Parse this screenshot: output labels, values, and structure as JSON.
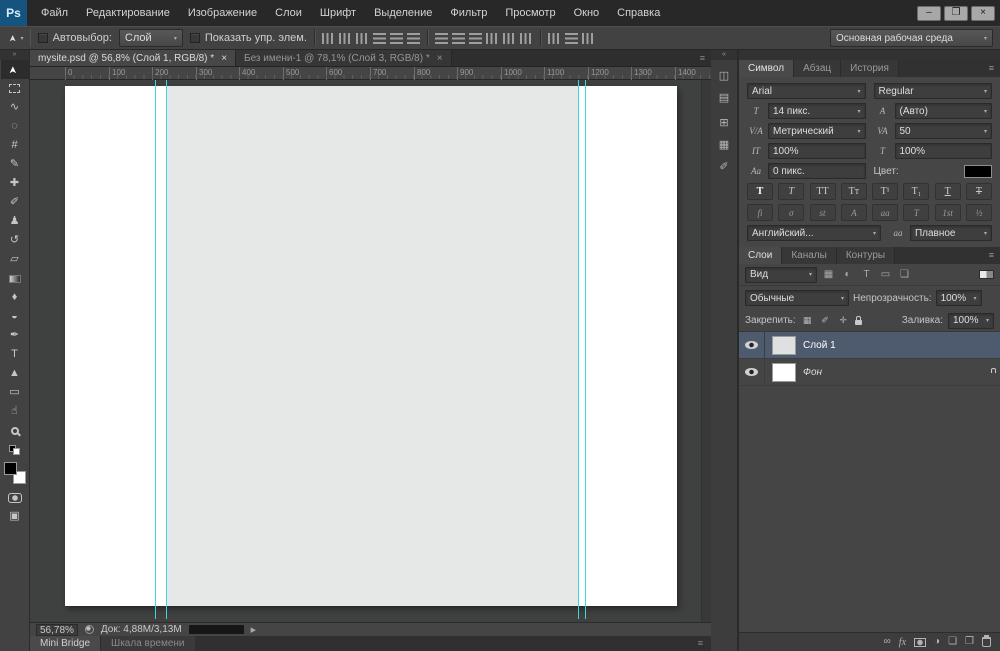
{
  "window": {
    "logo": "Ps",
    "controls": {
      "minimize": "–",
      "maximize": "❐",
      "close": "×"
    }
  },
  "menubar": {
    "items": [
      "Файл",
      "Редактирование",
      "Изображение",
      "Слои",
      "Шрифт",
      "Выделение",
      "Фильтр",
      "Просмотр",
      "Окно",
      "Справка"
    ]
  },
  "options_bar": {
    "autoselect_label": "Автовыбор:",
    "autoselect_value": "Слой",
    "show_controls_label": "Показать упр. элем.",
    "workspace": "Основная рабочая среда"
  },
  "document_tabs": [
    {
      "title": "mysite.psd @ 56,8% (Слой 1, RGB/8) *",
      "close": "×"
    },
    {
      "title": "Без имени-1 @ 78,1% (Слой 3, RGB/8) *",
      "close": "×"
    }
  ],
  "ruler_ticks": [
    "0",
    "100",
    "200",
    "300",
    "400",
    "500",
    "600",
    "700",
    "800",
    "900",
    "1000",
    "1100",
    "1200",
    "1300",
    "1400"
  ],
  "status_bar": {
    "zoom": "56,78%",
    "doc_info": "Док: 4,88М/3,13М",
    "arrow": "▶"
  },
  "bottom_tabs": {
    "mini_bridge": "Mini Bridge",
    "timeline": "Шкала времени"
  },
  "character_panel": {
    "tab_character": "Символ",
    "tab_paragraph": "Абзац",
    "tab_history": "История",
    "font_family": "Arial",
    "font_style": "Regular",
    "font_size": "14 пикс.",
    "leading": "(Авто)",
    "kerning": "Метрический",
    "tracking": "50",
    "vertical_scale": "100%",
    "horizontal_scale": "100%",
    "baseline_shift": "0 пикс.",
    "color_label": "Цвет:",
    "style_buttons": [
      "T",
      "T",
      "TT",
      "Tт",
      "T¹",
      "T₁",
      "T",
      "T"
    ],
    "opentype_buttons": [
      "fi",
      "σ",
      "st",
      "A",
      "aa",
      "T",
      "1st",
      "½"
    ],
    "language": "Английский...",
    "antialias_icon": "aa",
    "antialias": "Плавное"
  },
  "layers_panel": {
    "tab_layers": "Слои",
    "tab_channels": "Каналы",
    "tab_paths": "Контуры",
    "filter_label": "Вид",
    "blend_mode": "Обычные",
    "opacity_label": "Непрозрачность:",
    "opacity_value": "100%",
    "lock_label": "Закрепить:",
    "fill_label": "Заливка:",
    "fill_value": "100%",
    "layers": [
      {
        "name": "Слой 1"
      },
      {
        "name": "Фон"
      }
    ]
  },
  "icons": {
    "dropdown_arrow": "▾",
    "hamburger": "≡",
    "double_arrow_right": "»",
    "double_arrow_left": "«",
    "move": "➤",
    "lasso": "∿",
    "quick_select": "◌",
    "crop": "#",
    "eyedropper": "✎",
    "healing": "✚",
    "brush": "✐",
    "stamp": "♟",
    "history": "↺",
    "eraser": "▱",
    "blur": "♦",
    "dodge": "◒",
    "pen": "✒",
    "type": "T",
    "path": "▲",
    "shape": "▭",
    "hand": "☝",
    "screen_mode": "▣",
    "size_icon": "T",
    "leading_icon": "A",
    "kerning_icon": "V/A",
    "tracking_icon": "VA",
    "vscale_icon": "IT",
    "hscale_icon": "T",
    "baseline_icon": "Aa",
    "filter_pixel": "▦",
    "filter_adjust": "◐",
    "filter_type": "T",
    "filter_shape": "▭",
    "filter_smart": "❏",
    "lock_checker": "▦",
    "lock_brush": "✐",
    "lock_move": "✛",
    "link": "∞",
    "fx": "fx",
    "adjustment": "◑",
    "folder": "❏",
    "new_layer": "❐",
    "collapsed_1": "◫",
    "collapsed_2": "▤",
    "collapsed_3": "⊞",
    "collapsed_4": "▦",
    "collapsed_5": "✐"
  },
  "colors": {
    "logo_blue": "#14547f",
    "guide_cyan": "#3fd6e0",
    "selected_layer": "#4e5a6e"
  }
}
